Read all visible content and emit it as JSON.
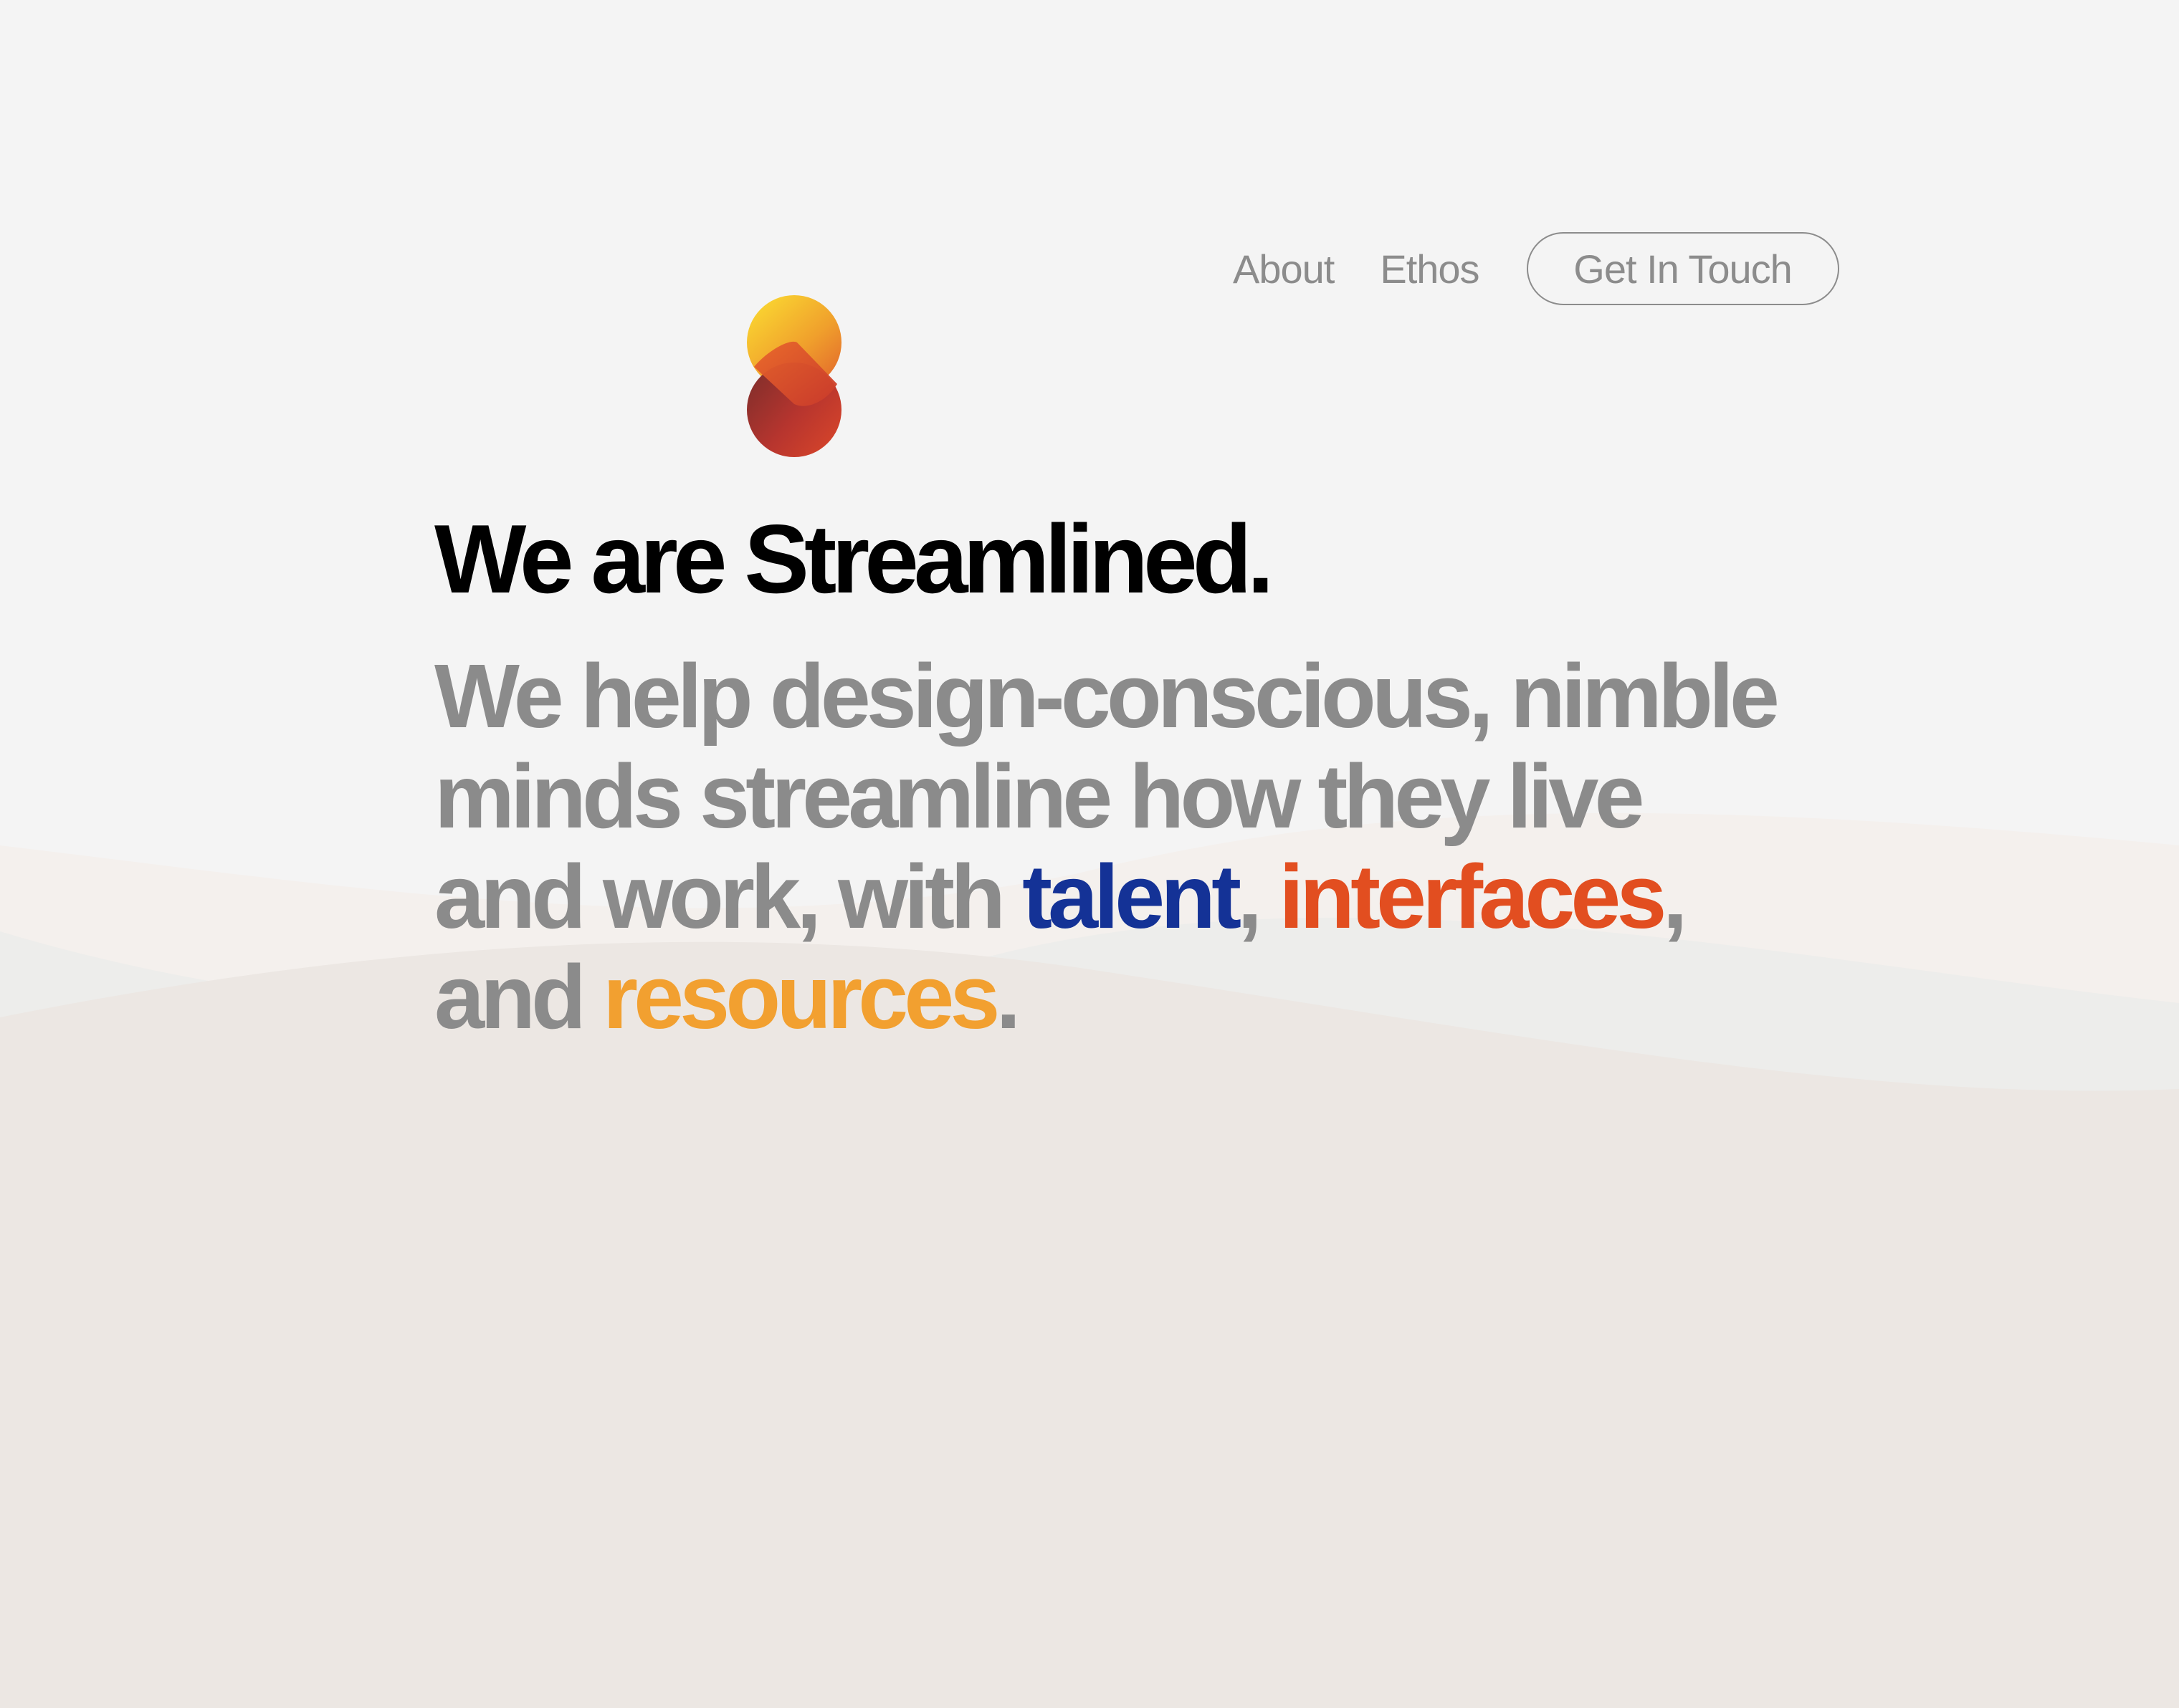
{
  "nav": {
    "links": [
      {
        "label": "About"
      },
      {
        "label": "Ethos"
      }
    ],
    "cta_label": "Get In Touch"
  },
  "logo": {
    "icon": "streamlined-s-logo-icon",
    "colors": [
      "#f9d231",
      "#ee8a28",
      "#d6442a",
      "#8a2f2c"
    ]
  },
  "hero": {
    "headline": "We are Streamlined.",
    "lede": {
      "intro": "We help design-conscious, nimble minds streamline how they live and work, with ",
      "talent": "talent",
      "sep1": ", ",
      "interfaces": "interfaces",
      "sep2": ", and ",
      "resources": "resources",
      "end": "."
    }
  },
  "colors": {
    "background": "#f4f4f4",
    "muted_text": "#8b8b8b",
    "talent": "#143296",
    "interfaces": "#e24e20",
    "resources": "#f2a030"
  }
}
